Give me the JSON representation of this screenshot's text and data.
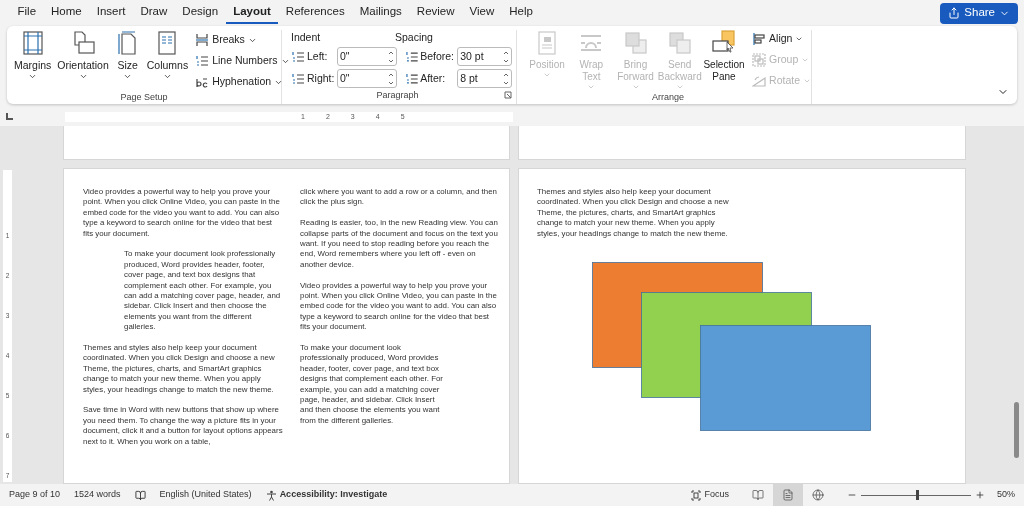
{
  "menu_tabs": [
    {
      "label": "File",
      "selected": false
    },
    {
      "label": "Home",
      "selected": false
    },
    {
      "label": "Insert",
      "selected": false
    },
    {
      "label": "Draw",
      "selected": false
    },
    {
      "label": "Design",
      "selected": false
    },
    {
      "label": "Layout",
      "selected": true
    },
    {
      "label": "References",
      "selected": false
    },
    {
      "label": "Mailings",
      "selected": false
    },
    {
      "label": "Review",
      "selected": false
    },
    {
      "label": "View",
      "selected": false
    },
    {
      "label": "Help",
      "selected": false
    }
  ],
  "share_button": {
    "label": "Share"
  },
  "ribbon": {
    "page_setup": {
      "label": "Page Setup",
      "large_buttons": [
        {
          "label": "Margins"
        },
        {
          "label": "Orientation"
        },
        {
          "label": "Size"
        },
        {
          "label": "Columns"
        }
      ],
      "small_buttons": [
        {
          "label": "Breaks"
        },
        {
          "label": "Line Numbers"
        },
        {
          "label": "Hyphenation"
        }
      ]
    },
    "paragraph": {
      "label": "Paragraph",
      "indent_label": "Indent",
      "spacing_label": "Spacing",
      "fields": [
        {
          "label": "Left:",
          "value": "0\""
        },
        {
          "label": "Before:",
          "value": "30 pt"
        },
        {
          "label": "Right:",
          "value": "0\""
        },
        {
          "label": "After:",
          "value": "8 pt"
        }
      ]
    },
    "arrange": {
      "label": "Arrange",
      "large_buttons": [
        {
          "label": "Position",
          "disabled": true,
          "caret": true
        },
        {
          "label": "Wrap Text",
          "disabled": true,
          "caret": true
        },
        {
          "label": "Bring Forward",
          "disabled": true,
          "caret": true
        },
        {
          "label": "Send Backward",
          "disabled": true,
          "caret": true
        },
        {
          "label": "Selection Pane",
          "disabled": false,
          "caret": false
        }
      ],
      "small_buttons": [
        {
          "label": "Align",
          "disabled": false
        },
        {
          "label": "Group",
          "disabled": true
        },
        {
          "label": "Rotate",
          "disabled": true
        }
      ]
    }
  },
  "ruler": {
    "numbers": [
      "1",
      "2",
      "3",
      "4",
      "5"
    ]
  },
  "vertical_ruler": {
    "numbers": [
      "1",
      "2",
      "3",
      "4",
      "5",
      "6",
      "7"
    ]
  },
  "left_page": {
    "columns": [
      [
        {
          "kind": "normal",
          "text": "Video provides a powerful way to help you prove your point. When you click Online Video, you can paste in the embed code for the video you want to add. You can also type a keyword to search online for the video that best fits your document."
        },
        {
          "kind": "indented",
          "text": "To make your document look professionally produced, Word provides header, footer, cover page, and text box designs that complement each other. For example, you can add a matching cover page, header, and sidebar. Click Insert and then choose the elements you want from the different galleries."
        },
        {
          "kind": "normal",
          "text": "Themes and styles also help keep your document coordinated. When you click Design and choose a new Theme, the pictures, charts, and SmartArt graphics change to match your new theme. When you apply styles, your headings change to match the new theme."
        },
        {
          "kind": "normal",
          "text": "Save time in Word with new buttons that show up where you need them. To change the way a picture fits in your document, click it and a button for layout options appears next to it. When you work on a table,"
        }
      ],
      [
        {
          "kind": "normal",
          "text": "click where you want to add a row or a column, and then click the plus sign."
        },
        {
          "kind": "normal",
          "text": "Reading is easier, too, in the new Reading view. You can collapse parts of the document and focus on the text you want. If you need to stop reading before you reach the end, Word remembers where you left off - even on another device."
        },
        {
          "kind": "normal",
          "text": "Video provides a powerful way to help you prove your point. When you click Online Video, you can paste in the embed code for the video you want to add. You can also type a keyword to search online for the video that best fits your document."
        },
        {
          "kind": "narrow",
          "text": "To make your document look professionally produced, Word provides header, footer, cover page, and text box designs that complement each other. For example, you can add a matching cover page, header, and sidebar. Click Insert and then choose the elements you want from the different galleries."
        }
      ]
    ]
  },
  "right_page": {
    "paragraphs": [
      {
        "text": "Themes and styles also help keep your document coordinated. When you click Design and choose a new Theme, the pictures, charts, and SmartArt graphics change to match your new theme. When you apply styles, your headings change to match the new theme."
      }
    ],
    "shapes": [
      {
        "color": "#ed7d31"
      },
      {
        "color": "#92d050"
      },
      {
        "color": "#5b9bd5"
      }
    ]
  },
  "status_bar": {
    "page": "Page 9 of 10",
    "words": "1524 words",
    "language": "English (United States)",
    "accessibility": "Accessibility: Investigate",
    "focus": "Focus",
    "views": [
      {
        "kind": "read",
        "selected": false
      },
      {
        "kind": "print",
        "selected": true
      },
      {
        "kind": "web",
        "selected": false
      }
    ],
    "zoom": {
      "level": 0.5,
      "reading": "50%"
    }
  }
}
